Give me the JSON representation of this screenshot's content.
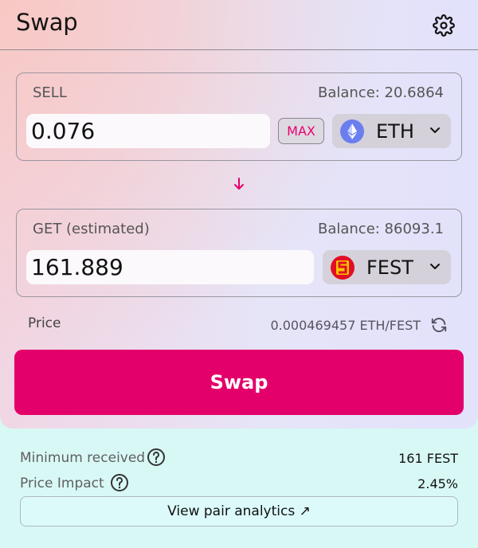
{
  "header": {
    "title": "Swap",
    "settings_icon": "gear-icon"
  },
  "sell": {
    "label": "SELL",
    "balance": "Balance: 20.6864",
    "amount": "0.076",
    "max_label": "MAX",
    "token": "ETH",
    "token_icon": "ethereum-icon"
  },
  "get": {
    "label": "GET (estimated)",
    "balance": "Balance: 86093.1",
    "amount": "161.889",
    "token": "FEST",
    "token_icon": "fest-token-icon"
  },
  "price": {
    "label": "Price",
    "value": "0.000469457 ETH/FEST"
  },
  "swap_button": {
    "label": "Swap"
  },
  "details": {
    "minimum_received_label": "Minimum received",
    "minimum_received_value": "161 FEST",
    "price_impact_label": "Price Impact",
    "price_impact_value": "2.45%"
  },
  "analytics": {
    "label": "View pair analytics",
    "arrow": "↗"
  },
  "colors": {
    "accent": "#e4006a",
    "eth_blue": "#6a7ef0",
    "fest_red": "#e20f23",
    "fest_yellow": "#f7c300",
    "details_bg": "#d8f8f6"
  }
}
